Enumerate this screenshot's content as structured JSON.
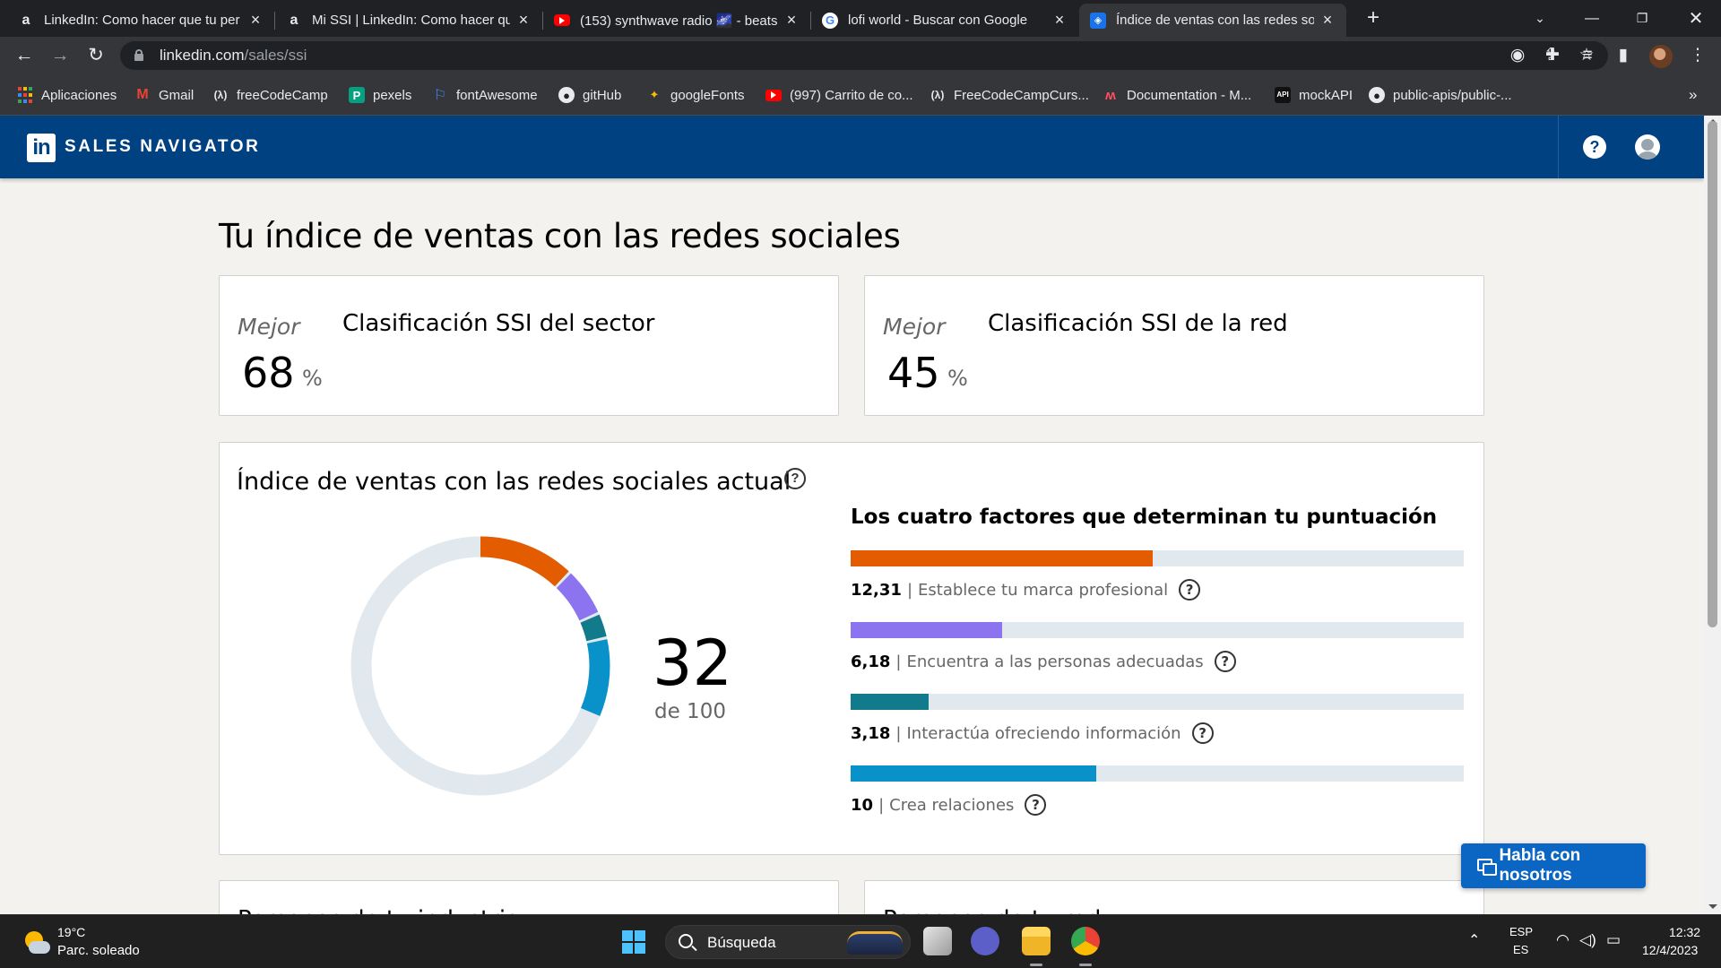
{
  "browser": {
    "tabs": [
      {
        "title": "LinkedIn: Como hacer que tu per",
        "favicon": "a"
      },
      {
        "title": "Mi SSI | LinkedIn: Como hacer qu",
        "favicon": "a"
      },
      {
        "title": "(153) synthwave radio 🌌 - beats",
        "favicon": "youtube"
      },
      {
        "title": "lofi world - Buscar con Google",
        "favicon": "G"
      },
      {
        "title": "Índice de ventas con las redes so",
        "favicon": "ssi"
      }
    ],
    "url_host": "linkedin.com",
    "url_path": "/sales/ssi",
    "bookmarks": [
      {
        "label": "Aplicaciones",
        "icon": "apps-grid-icon"
      },
      {
        "label": "Gmail",
        "icon": "gmail-icon"
      },
      {
        "label": "freeCodeCamp",
        "icon": "freecodecamp-icon"
      },
      {
        "label": "pexels",
        "icon": "pexels-icon"
      },
      {
        "label": "fontAwesome",
        "icon": "flag-icon"
      },
      {
        "label": "gitHub",
        "icon": "github-icon"
      },
      {
        "label": "googleFonts",
        "icon": "googlefonts-icon"
      },
      {
        "label": "(997) Carrito de co...",
        "icon": "youtube-icon"
      },
      {
        "label": "FreeCodeCampCurs...",
        "icon": "freecodecamp-icon"
      },
      {
        "label": "Documentation - M...",
        "icon": "mui-icon"
      },
      {
        "label": "mockAPI",
        "icon": "mockapi-icon"
      },
      {
        "label": "public-apis/public-...",
        "icon": "github-icon"
      }
    ]
  },
  "header": {
    "logo": "in",
    "title": "SALES NAVIGATOR",
    "help": "?"
  },
  "page": {
    "title": "Tu índice de ventas con las redes sociales"
  },
  "rankings": {
    "industry": {
      "better_label": "Mejor",
      "value": "68",
      "unit": "%",
      "label": "Clasificación SSI del sector"
    },
    "network": {
      "better_label": "Mejor",
      "value": "45",
      "unit": "%",
      "label": "Clasificación SSI de la red"
    }
  },
  "ssi": {
    "heading": "Índice de ventas con las redes sociales actual",
    "score": "32",
    "score_of": "de 100",
    "factors_title": "Los cuatro factores que determinan tu puntuación",
    "factors": [
      {
        "value": "12,31",
        "label": "Establece tu marca profesional",
        "fraction": 0.4924,
        "color": "#e35c00"
      },
      {
        "value": "6,18",
        "label": "Encuentra a las personas adecuadas",
        "fraction": 0.2472,
        "color": "#8c74f0"
      },
      {
        "value": "3,18",
        "label": "Interactúa ofreciendo información",
        "fraction": 0.1272,
        "color": "#117a8b"
      },
      {
        "value": "10",
        "label": "Crea relaciones",
        "fraction": 0.4,
        "color": "#0991c9"
      }
    ],
    "track_color": "#e1e9ee"
  },
  "lower_cards": {
    "left_heading": "Personas de tu industria",
    "right_heading": "Personas de tu red"
  },
  "chat": {
    "label": "Habla con nosotros"
  },
  "taskbar": {
    "temperature": "19°C",
    "condition": "Parc. soleado",
    "search_placeholder": "Búsqueda",
    "lang_top": "ESP",
    "lang_bottom": "ES",
    "time": "12:32",
    "date": "12/4/2023"
  }
}
